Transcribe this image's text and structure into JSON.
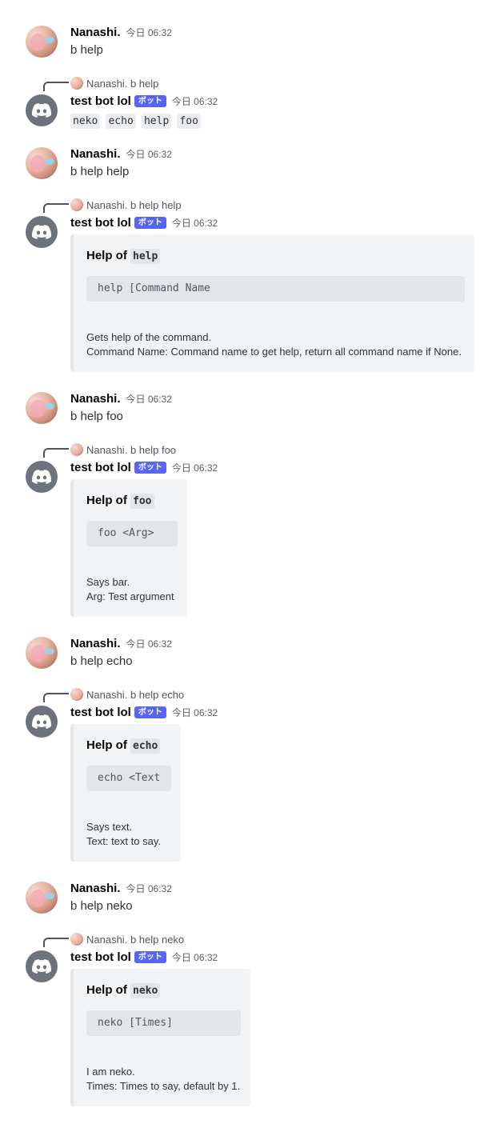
{
  "messages": [
    {
      "author": "Nanashi.",
      "time": "今日 06:32",
      "text": "b help"
    },
    {
      "author": "test bot lol",
      "badge": "ボット",
      "time": "今日 06:32",
      "reply_to": {
        "author": "Nanashi.",
        "text": "b help"
      },
      "commands": [
        "neko",
        "echo",
        "help",
        "foo"
      ]
    },
    {
      "author": "Nanashi.",
      "time": "今日 06:32",
      "text": "b help help"
    },
    {
      "author": "test bot lol",
      "badge": "ボット",
      "time": "今日 06:32",
      "reply_to": {
        "author": "Nanashi.",
        "text": "b help help"
      },
      "embed": {
        "title_prefix": "Help of",
        "title_code": "help",
        "usage": "help [Command Name",
        "desc": [
          "Gets help of the command.",
          "Command Name: Command name to get help, return all command name if None."
        ]
      }
    },
    {
      "author": "Nanashi.",
      "time": "今日 06:32",
      "text": "b help foo"
    },
    {
      "author": "test bot lol",
      "badge": "ボット",
      "time": "今日 06:32",
      "reply_to": {
        "author": "Nanashi.",
        "text": "b help foo"
      },
      "embed": {
        "title_prefix": "Help of",
        "title_code": "foo",
        "usage": "foo <Arg>",
        "desc": [
          "Says bar.",
          "Arg: Test argument"
        ]
      }
    },
    {
      "author": "Nanashi.",
      "time": "今日 06:32",
      "text": "b help echo"
    },
    {
      "author": "test bot lol",
      "badge": "ボット",
      "time": "今日 06:32",
      "reply_to": {
        "author": "Nanashi.",
        "text": "b help echo"
      },
      "embed": {
        "title_prefix": "Help of",
        "title_code": "echo",
        "usage": "echo <Text",
        "desc": [
          "Says text.",
          "Text: text to say."
        ]
      }
    },
    {
      "author": "Nanashi.",
      "time": "今日 06:32",
      "text": "b help neko"
    },
    {
      "author": "test bot lol",
      "badge": "ボット",
      "time": "今日 06:32",
      "reply_to": {
        "author": "Nanashi.",
        "text": "b help neko"
      },
      "embed": {
        "title_prefix": "Help of",
        "title_code": "neko",
        "usage": "neko [Times]",
        "desc": [
          "I am neko.",
          "Times: Times to say, default by 1."
        ]
      }
    }
  ],
  "colors": {
    "badge": "#5865f2",
    "embed_bg": "#f2f3f5",
    "embed_border": "#e3e5e8",
    "bot_avatar": "#6d737d"
  },
  "icons": {
    "bot_avatar": "discord-logo-icon",
    "reply": "reply-spine-icon"
  }
}
